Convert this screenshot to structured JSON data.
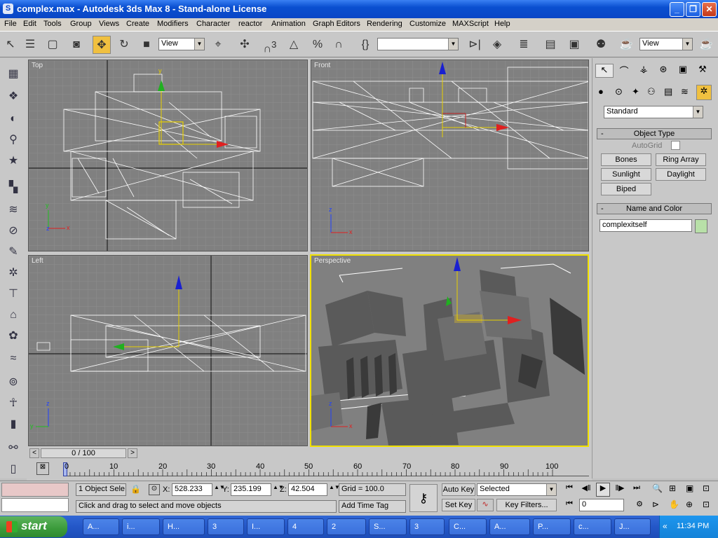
{
  "window": {
    "title": "complex.max - Autodesk 3ds Max 8 - Stand-alone License"
  },
  "menu": [
    "File",
    "Edit",
    "Tools",
    "Group",
    "Views",
    "Create",
    "Modifiers",
    "Character",
    "reactor",
    "Animation",
    "Graph Editors",
    "Rendering",
    "Customize",
    "MAXScript",
    "Help"
  ],
  "toolbar": {
    "ref_coord": "View",
    "selection_set": "",
    "view_right": "View",
    "snap_label": "3"
  },
  "viewports": {
    "top": "Top",
    "front": "Front",
    "left": "Left",
    "perspective": "Perspective"
  },
  "command_panel": {
    "category": "Standard",
    "object_type": {
      "header": "Object Type",
      "autogrid": "AutoGrid",
      "buttons": [
        "Bones",
        "Ring Array",
        "Sunlight",
        "Daylight",
        "Biped"
      ]
    },
    "name_color": {
      "header": "Name and Color",
      "name_value": "complexitself",
      "color": "#b8e0a8"
    }
  },
  "timeline": {
    "position": "0 / 100",
    "ticks": [
      "0",
      "10",
      "20",
      "30",
      "40",
      "50",
      "60",
      "70",
      "80",
      "90",
      "100"
    ]
  },
  "status": {
    "selection": "1 Object Sele",
    "x_label": "X:",
    "x": "528.233",
    "y_label": "Y:",
    "y": "235.199",
    "z_label": "Z:",
    "z": "42.504",
    "grid": "Grid = 100.0",
    "prompt": "Click and drag to select and move objects",
    "add_time_tag": "Add Time Tag",
    "auto_key": "Auto Key",
    "set_key": "Set Key",
    "key_mode": "Selected",
    "key_filters": "Key Filters...",
    "frame": "0"
  },
  "taskbar": {
    "start": "start",
    "tasks": [
      "A...",
      "i...",
      "H...",
      "3",
      "I...",
      "4",
      "2",
      "S...",
      "3",
      "C...",
      "A...",
      "P...",
      "c...",
      "J..."
    ],
    "clock": "11:34 PM"
  }
}
